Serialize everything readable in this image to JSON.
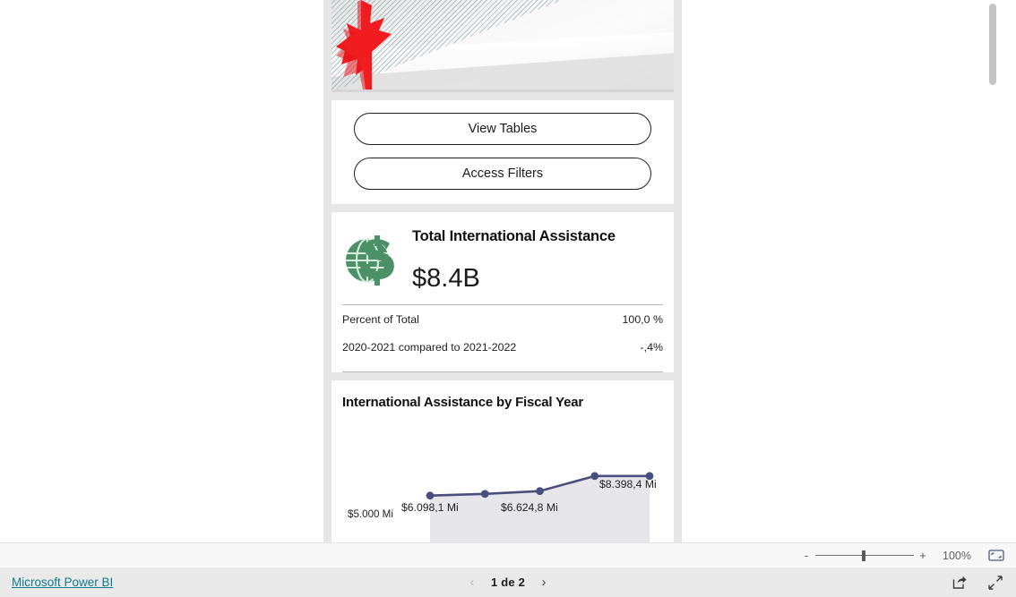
{
  "report": {
    "banner": {
      "icon": "canada-maple-leaf-icon",
      "alt": "Government of Canada banner"
    },
    "actions": {
      "view_tables_label": "View Tables",
      "access_filters_label": "Access Filters"
    },
    "kpi": {
      "icon": "globe-dollar-icon",
      "title": "Total International Assistance",
      "value": "$8.4B",
      "stats": [
        {
          "label": "Percent of Total",
          "value": "100,0 %"
        },
        {
          "label": "2020-2021 compared to 2021-2022",
          "value": "-,4%"
        }
      ]
    }
  },
  "chart_data": {
    "type": "line",
    "title": "International Assistance by Fiscal Year",
    "xlabel": "",
    "ylabel": "",
    "grid": false,
    "legend": "none",
    "line_color": "#4a4e7e",
    "area_fill": "#e5e5ea",
    "ylim": [
      5000,
      8800
    ],
    "ytick_labels": [
      "$5.000 Mi"
    ],
    "categories": [
      "",
      "",
      "",
      "",
      ""
    ],
    "values": [
      6098.1,
      6300.0,
      6624.8,
      8398.4,
      8398.4
    ],
    "point_labels": [
      "$6.098,1 Mi",
      "",
      "$6.624,8 Mi",
      "$8.398,4 Mi",
      ""
    ],
    "series": [
      {
        "name": "International Assistance",
        "values": [
          6098.1,
          6300.0,
          6624.8,
          8398.4,
          8398.4
        ]
      }
    ]
  },
  "viewer": {
    "zoom": {
      "minus_label": "-",
      "plus_label": "+",
      "level": "100%",
      "fit_icon": "fit-to-page-icon"
    },
    "footer": {
      "brand_link": "Microsoft Power BI",
      "prev_arrow": "‹",
      "next_arrow": "›",
      "page_label": "1 de 2",
      "share_icon": "share-icon",
      "fullscreen_icon": "fullscreen-icon"
    }
  }
}
